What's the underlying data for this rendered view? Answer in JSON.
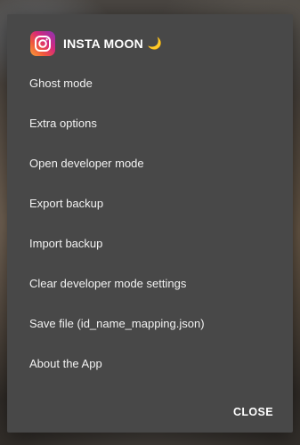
{
  "dialog": {
    "title": "INSTA MOON",
    "title_emoji": "🌙",
    "icon": "instagram-icon",
    "menu": [
      {
        "id": "ghost-mode",
        "label": "Ghost mode"
      },
      {
        "id": "extra-options",
        "label": "Extra options"
      },
      {
        "id": "open-developer-mode",
        "label": "Open developer mode"
      },
      {
        "id": "export-backup",
        "label": "Export backup"
      },
      {
        "id": "import-backup",
        "label": "Import backup"
      },
      {
        "id": "clear-developer-mode-settings",
        "label": "Clear developer mode settings"
      },
      {
        "id": "save-file",
        "label": "Save file (id_name_mapping.json)"
      },
      {
        "id": "about-the-app",
        "label": "About the App"
      }
    ],
    "close_label": "CLOSE"
  },
  "colors": {
    "dialog_bg": "#484848",
    "text": "#f2f2f2",
    "moon": "#f5c242"
  }
}
